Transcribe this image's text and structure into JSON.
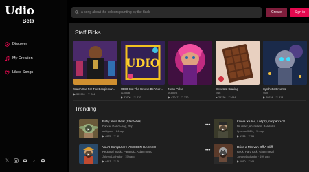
{
  "brand": {
    "name": "Udio",
    "sub": "Beta"
  },
  "nav": [
    {
      "icon": "compass-icon",
      "label": "Discover"
    },
    {
      "icon": "music-note-icon",
      "label": "My Creation"
    },
    {
      "icon": "heart-icon",
      "label": "Liked Songs"
    }
  ],
  "social": [
    "twitter-icon",
    "instagram-icon",
    "discord-icon",
    "tiktok-icon",
    "reddit-icon"
  ],
  "search": {
    "placeholder": "a song about the colours painting by the flask",
    "icon": "search-icon"
  },
  "header": {
    "create": "Create",
    "signin": "Sign in"
  },
  "colors": {
    "accent": "#e5094f",
    "create_bg": "#7f1d3b",
    "panel": "#1f1f1f"
  },
  "staff_picks": {
    "title": "Staff Picks",
    "cards": [
      {
        "title": "Watch Out For The Boogieman...",
        "author": "",
        "plays": "309990",
        "likes": "264"
      },
      {
        "title": "UDIO Got The Groove Be Your ...",
        "author": "AuddyB",
        "plays": "87606",
        "likes": "470"
      },
      {
        "title": "Neon Pulse",
        "author": "AuddyB",
        "plays": "42047",
        "likes": "320"
      },
      {
        "title": "Sweetest Craving",
        "author": "Sw8",
        "plays": "29336",
        "likes": "494"
      },
      {
        "title": "Synthetic Dreams",
        "author": "Sw8",
        "plays": "48634",
        "likes": "314"
      }
    ]
  },
  "trending": {
    "title": "Trending",
    "items": [
      {
        "title": "Baby Yoda Beat (Star Wars)",
        "genre": "Dance, Dance-pop, Pop",
        "user": "avidgamr",
        "age": "24 ago",
        "plays": "4075",
        "likes": "43"
      },
      {
        "title": "Какие же вы, к чёрту, патриоты?!",
        "genre": "Drum kit, Accordion, Balalaika",
        "user": "КрасныйВЕЦ",
        "age": "7h ago",
        "plays": "1736",
        "likes": "35"
      },
      {
        "title": "YouR CompUter HAS BEEN HACKED",
        "genre": "Regional music, Paranoid, Asian music",
        "user": "JohnnyLuchador",
        "age": "15h ago",
        "plays": "4413",
        "likes": "79"
      },
      {
        "title": "Drive a Minivan Off A Cliff",
        "genre": "Rock, Hard rock, Glam metal",
        "user": "JohnnyLuchador",
        "age": "19h ago",
        "plays": "1990",
        "likes": "45"
      }
    ]
  }
}
